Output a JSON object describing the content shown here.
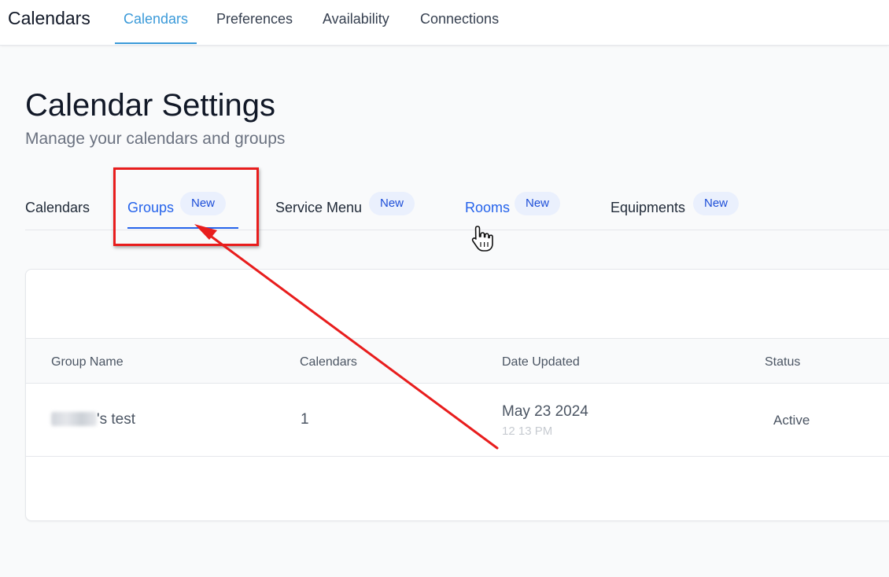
{
  "header": {
    "app_title": "Calendars",
    "tabs": [
      {
        "label": "Calendars",
        "active": true
      },
      {
        "label": "Preferences",
        "active": false
      },
      {
        "label": "Availability",
        "active": false
      },
      {
        "label": "Connections",
        "active": false
      }
    ]
  },
  "page": {
    "title": "Calendar Settings",
    "subtitle": "Manage your calendars and groups"
  },
  "subtabs": [
    {
      "label": "Calendars",
      "badge": ""
    },
    {
      "label": "Groups",
      "badge": "New",
      "active": true
    },
    {
      "label": "Service Menu",
      "badge": "New"
    },
    {
      "label": "Rooms",
      "badge": "New",
      "hovered": true
    },
    {
      "label": "Equipments",
      "badge": "New"
    }
  ],
  "table": {
    "columns": [
      "Group Name",
      "Calendars",
      "Date Updated",
      "Status"
    ],
    "rows": [
      {
        "group_name": "'s test",
        "calendars": "1",
        "date": "May 23 2024",
        "time": "12 13 PM",
        "status": "Active"
      }
    ]
  },
  "colors": {
    "accent": "#3b9ad9",
    "link": "#2563eb",
    "annotation": "#e81d1d"
  },
  "icons": [
    "hand-pointer-icon"
  ]
}
